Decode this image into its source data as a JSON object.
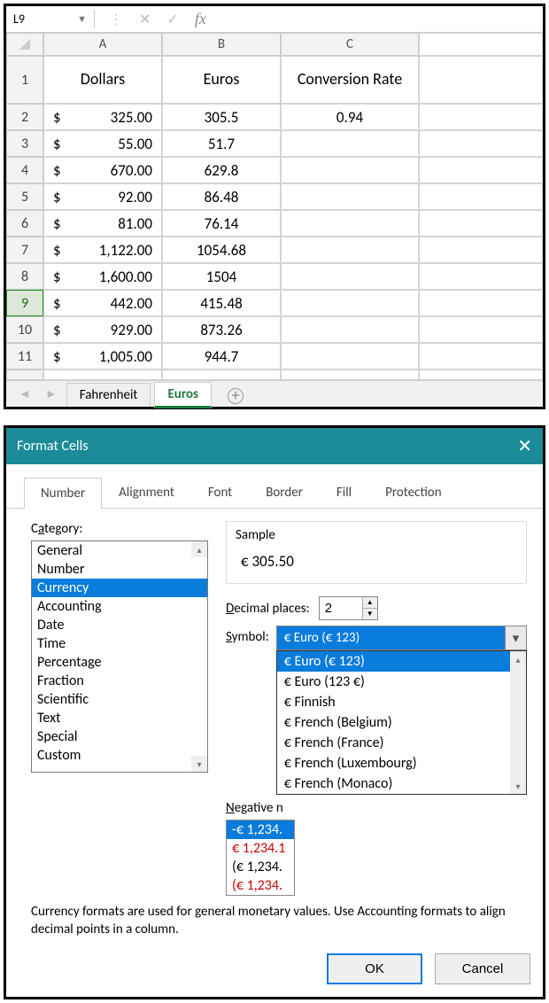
{
  "formula_bar": {
    "name_box": "L9"
  },
  "columns": [
    "A",
    "B",
    "C"
  ],
  "headers": {
    "a": "Dollars",
    "b": "Euros",
    "c": "Conversion Rate"
  },
  "rows": [
    {
      "n": "1"
    },
    {
      "n": "2",
      "sign": "$",
      "a": "325.00",
      "b": "305.5",
      "c": "0.94"
    },
    {
      "n": "3",
      "sign": "$",
      "a": "55.00",
      "b": "51.7",
      "c": ""
    },
    {
      "n": "4",
      "sign": "$",
      "a": "670.00",
      "b": "629.8",
      "c": ""
    },
    {
      "n": "5",
      "sign": "$",
      "a": "92.00",
      "b": "86.48",
      "c": ""
    },
    {
      "n": "6",
      "sign": "$",
      "a": "81.00",
      "b": "76.14",
      "c": ""
    },
    {
      "n": "7",
      "sign": "$",
      "a": "1,122.00",
      "b": "1054.68",
      "c": ""
    },
    {
      "n": "8",
      "sign": "$",
      "a": "1,600.00",
      "b": "1504",
      "c": ""
    },
    {
      "n": "9",
      "sign": "$",
      "a": "442.00",
      "b": "415.48",
      "c": ""
    },
    {
      "n": "10",
      "sign": "$",
      "a": "929.00",
      "b": "873.26",
      "c": ""
    },
    {
      "n": "11",
      "sign": "$",
      "a": "1,005.00",
      "b": "944.7",
      "c": ""
    }
  ],
  "selected_row": "9",
  "sheets": {
    "tab1": "Fahrenheit",
    "tab2": "Euros"
  },
  "dialog": {
    "title": "Format Cells",
    "tabs": {
      "number": "Number",
      "alignment": "Alignment",
      "font": "Font",
      "border": "Border",
      "fill": "Fill",
      "protection": "Protection"
    },
    "category_label_pre": "C",
    "category_label_ul": "a",
    "category_label_post": "tegory:",
    "categories": [
      "General",
      "Number",
      "Currency",
      "Accounting",
      "Date",
      "Time",
      "Percentage",
      "Fraction",
      "Scientific",
      "Text",
      "Special",
      "Custom"
    ],
    "selected_category": "Currency",
    "sample_label": "Sample",
    "sample_value": "€ 305.50",
    "decimal_label_ul": "D",
    "decimal_label_post": "ecimal places:",
    "decimal_value": "2",
    "symbol_label_ul": "S",
    "symbol_label_post": "ymbol:",
    "symbol_value": "€ Euro (€ 123)",
    "symbol_options": [
      "€ Euro (€ 123)",
      "€ Euro (123 €)",
      "€ Finnish",
      "€ French (Belgium)",
      "€ French (France)",
      "€ French (Luxembourg)",
      "€ French (Monaco)"
    ],
    "neg_label_ul": "N",
    "neg_label_post": "egative n",
    "neg_examples": [
      "-€ 1,234.",
      "€ 1,234.1",
      "(€ 1,234.",
      "(€ 1,234."
    ],
    "help_text": "Currency formats are used for general monetary values.  Use Accounting formats to align decimal points in a column.",
    "ok": "OK",
    "cancel": "Cancel"
  }
}
